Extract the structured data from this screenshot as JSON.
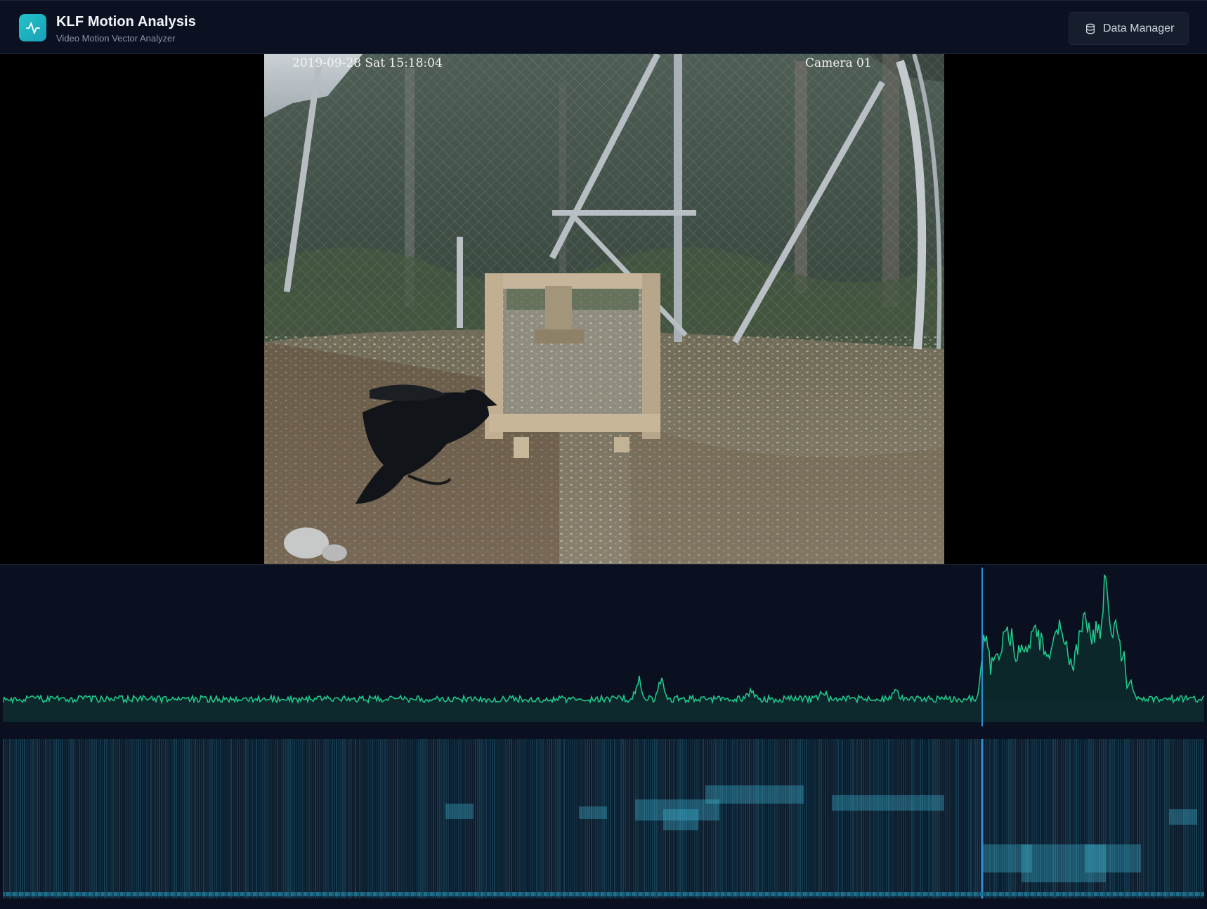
{
  "header": {
    "title": "KLF Motion Analysis",
    "subtitle": "Video Motion Vector Analyzer",
    "data_manager_label": "Data Manager",
    "logo_icon": "activity-pulse-icon",
    "button_icon": "database-icon"
  },
  "video": {
    "osd_timestamp": "2019-09-28 Sat 15:18:04",
    "osd_camera": "Camera 01"
  },
  "colors": {
    "accent": "#22c3c6",
    "motion_line": "#1fcf8f",
    "playhead": "#2a8fd8",
    "heatmap_glow": "#3fb6d8"
  },
  "timeline": {
    "playhead_fraction": 0.8152
  }
}
